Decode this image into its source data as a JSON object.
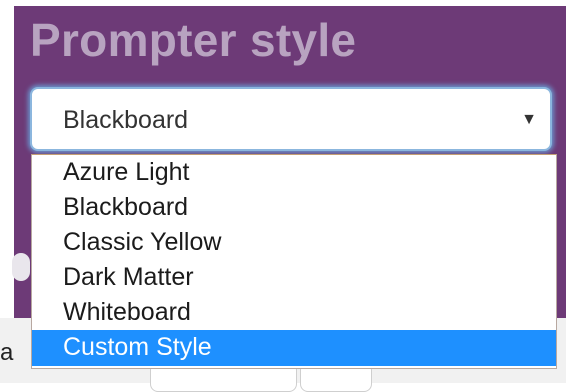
{
  "section": {
    "title": "Prompter style"
  },
  "style_select": {
    "selected_value": "Blackboard",
    "arrow_glyph": "▼",
    "options": [
      {
        "label": "Azure Light",
        "highlighted": false
      },
      {
        "label": "Blackboard",
        "highlighted": false
      },
      {
        "label": "Classic Yellow",
        "highlighted": false
      },
      {
        "label": "Dark Matter",
        "highlighted": false
      },
      {
        "label": "Whiteboard",
        "highlighted": false
      },
      {
        "label": "Custom Style",
        "highlighted": true
      }
    ]
  },
  "background": {
    "partial_text": "a"
  },
  "colors": {
    "panel": "#6d3a77",
    "title": "#b8a3c0",
    "focus_ring": "#8bb6de",
    "highlight": "#1e90ff"
  }
}
